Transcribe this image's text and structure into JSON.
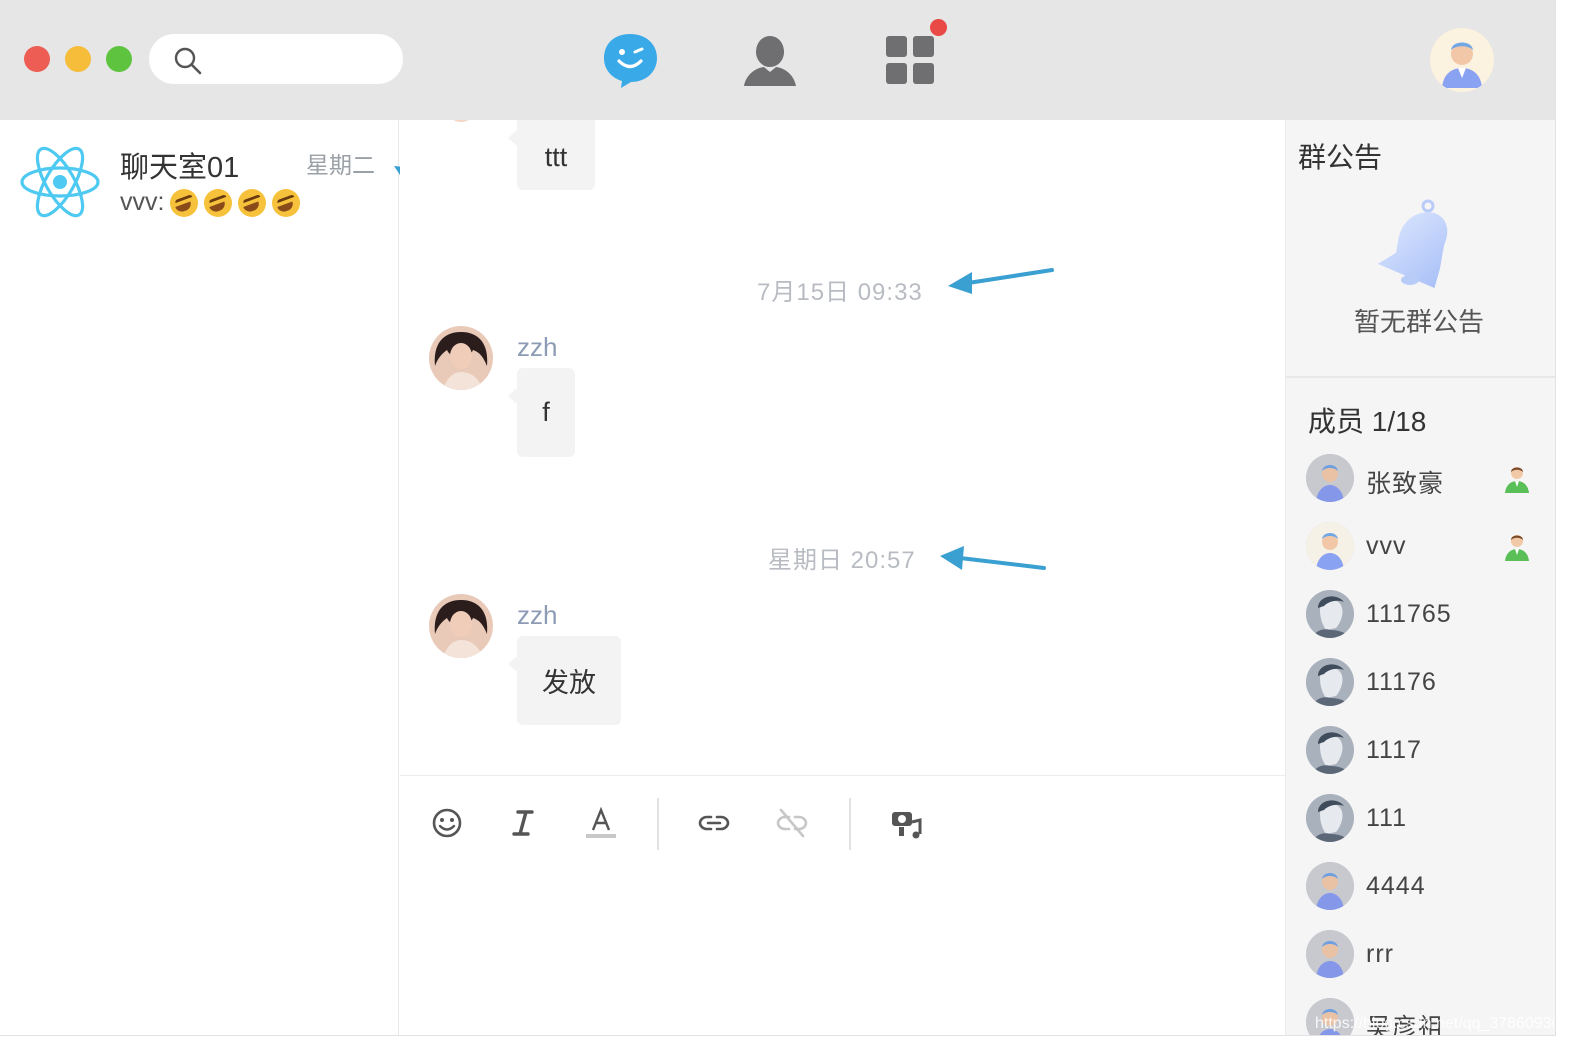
{
  "toolbar": {
    "search_placeholder": "",
    "nav": [
      "chat-icon",
      "contacts-icon",
      "apps-icon"
    ],
    "apps_badge_color": "#e94a45"
  },
  "conversations": [
    {
      "name": "聊天室01",
      "time": "星期二",
      "preview": "vvv:",
      "preview_emoji": [
        "rofl-emoji",
        "rofl-emoji",
        "rofl-emoji",
        "rofl-emoji"
      ]
    }
  ],
  "chat": {
    "top_message": "ttt",
    "timestamps": [
      "7月15日 09:33",
      "星期日 20:57"
    ],
    "messages": [
      {
        "sender": "zzh",
        "text": "f"
      },
      {
        "sender": "zzh",
        "text": "发放"
      }
    ]
  },
  "composer": {
    "tools": [
      "emoji-icon",
      "italic-icon",
      "font-color-icon",
      "link-icon",
      "unlink-icon",
      "media-icon"
    ]
  },
  "sidebar": {
    "notice_title": "群公告",
    "notice_empty": "暂无群公告",
    "members_title": "成员 1/18",
    "members": [
      {
        "name": "张致豪",
        "admin": true
      },
      {
        "name": "vvv",
        "admin": true
      },
      {
        "name": "111765",
        "admin": false
      },
      {
        "name": "11176",
        "admin": false
      },
      {
        "name": "1117",
        "admin": false
      },
      {
        "name": "111",
        "admin": false
      },
      {
        "name": "4444",
        "admin": false
      },
      {
        "name": "rrr",
        "admin": false
      },
      {
        "name": "吴彦祖",
        "admin": false
      }
    ]
  },
  "watermark": "https://blog.csdn.net/qq_37860930",
  "colors": {
    "accent": "#3aa9e8",
    "arrow": "#3a9fd1",
    "sender": "#8d9bb5"
  }
}
